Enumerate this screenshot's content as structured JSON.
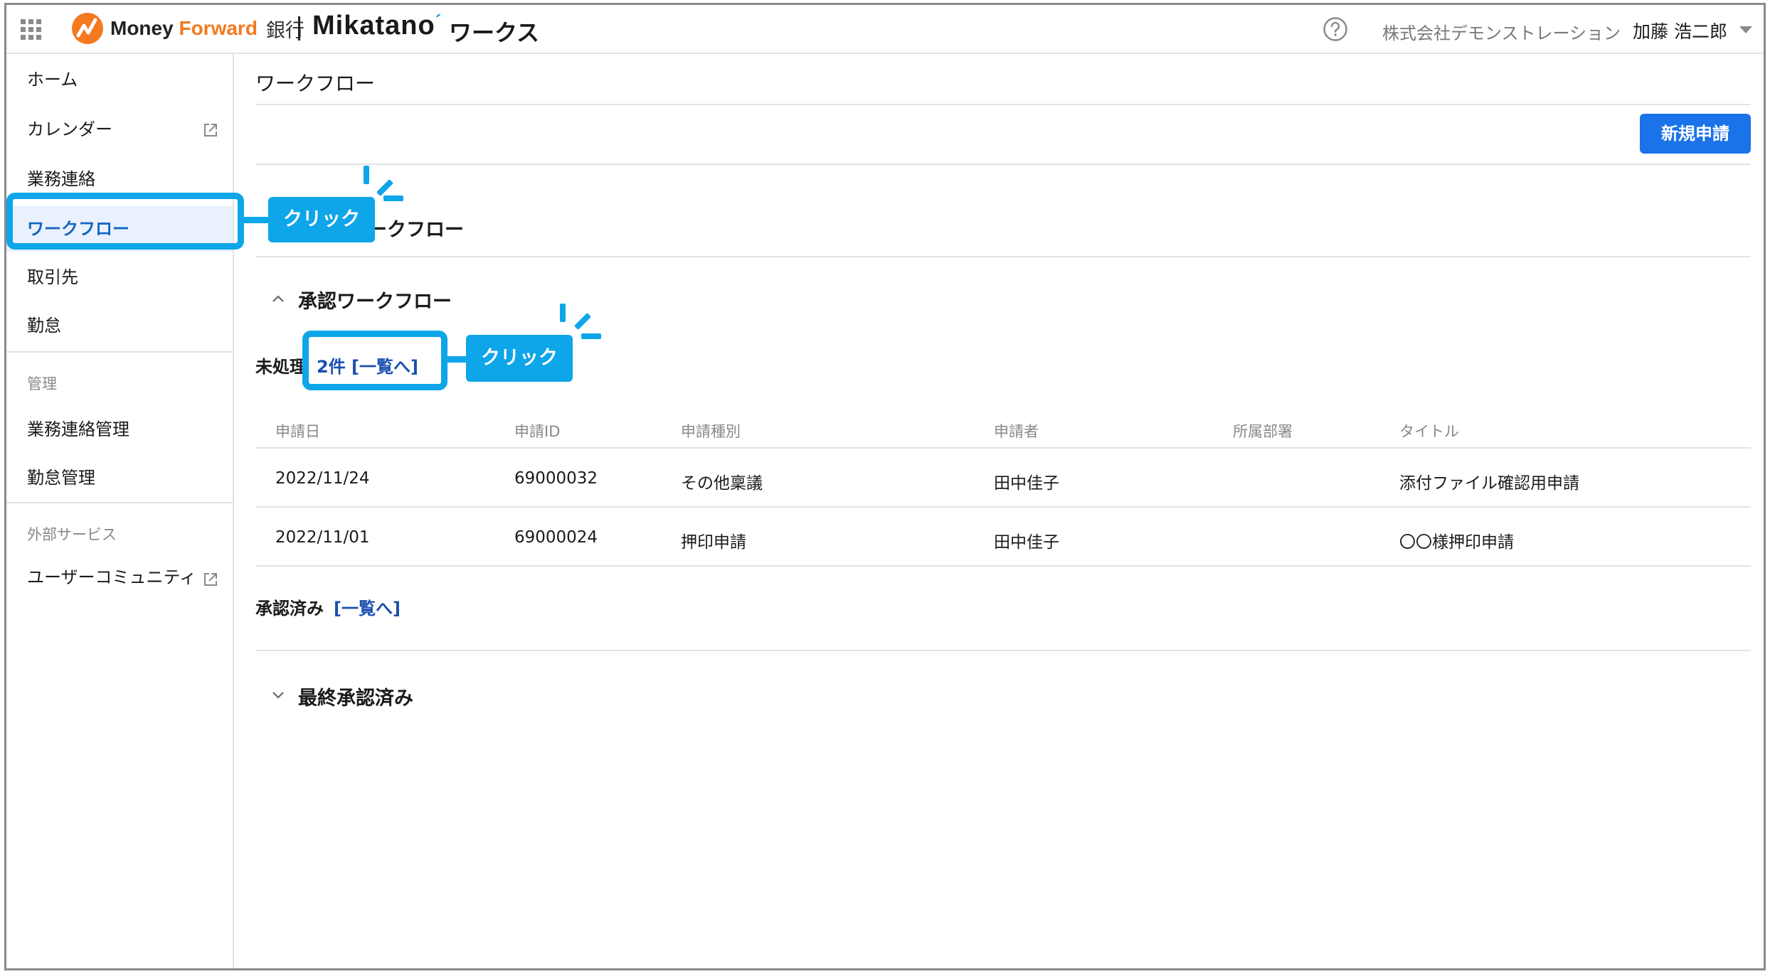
{
  "header": {
    "logo_part1": "Money ",
    "logo_part2": "Forward",
    "bank": "銀行",
    "product": "Mikatano",
    "product_suffix": "ワークス",
    "company": "株式会社デモンストレーション",
    "user": "加藤 浩二郎"
  },
  "sidebar": {
    "items": [
      {
        "label": "ホーム"
      },
      {
        "label": "カレンダー"
      },
      {
        "label": "業務連絡"
      },
      {
        "label": "ワークフロー"
      },
      {
        "label": "取引先"
      },
      {
        "label": "勤怠"
      }
    ],
    "section_admin": "管理",
    "admin_items": [
      {
        "label": "業務連絡管理"
      },
      {
        "label": "勤怠管理"
      }
    ],
    "section_external": "外部サービス",
    "external_items": [
      {
        "label": "ユーザーコミュニティ"
      }
    ]
  },
  "main": {
    "page_title": "ワークフロー",
    "new_button": "新規申請",
    "my_workflow_title": "ークフロー",
    "approval_title": "承認ワークフロー",
    "pending_label": "未処理",
    "pending_link": "2件 [一覧へ]",
    "columns": [
      "申請日",
      "申請ID",
      "申請種別",
      "申請者",
      "所属部署",
      "タイトル"
    ],
    "rows": [
      {
        "date": "2022/11/24",
        "id": "69000032",
        "type": "その他稟議",
        "applicant": "田中佳子",
        "dept": "",
        "title": "添付ファイル確認用申請"
      },
      {
        "date": "2022/11/01",
        "id": "69000024",
        "type": "押印申請",
        "applicant": "田中佳子",
        "dept": "",
        "title": "〇〇様押印申請"
      }
    ],
    "approved_label": "承認済み",
    "approved_link": "[一覧へ]",
    "final_title": "最終承認済み"
  },
  "annotations": {
    "callout1": "クリック",
    "callout2": "クリック"
  },
  "colors": {
    "accent": "#1a73e8",
    "callout": "#0ea5e9",
    "brand_orange": "#f47920"
  }
}
